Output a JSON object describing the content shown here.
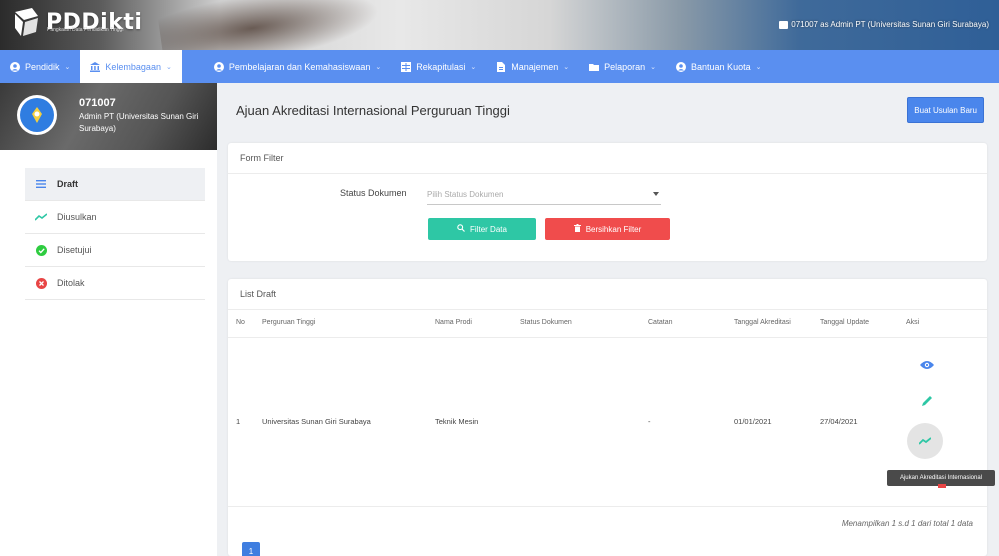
{
  "header": {
    "brand": "PDDikti",
    "brand_sub": "Pangkalan Data Pendidikan Tinggi",
    "user_label": "071007 as Admin PT (Universitas Sunan Giri Surabaya)"
  },
  "nav": {
    "items": [
      {
        "label": "Pendidik",
        "icon": "user-circle-icon"
      },
      {
        "label": "Kelembagaan",
        "icon": "institution-icon"
      },
      {
        "label": "Pembelajaran dan Kemahasiswaan",
        "icon": "user-circle-icon"
      },
      {
        "label": "Rekapitulasi",
        "icon": "table-icon"
      },
      {
        "label": "Manajemen",
        "icon": "document-icon"
      },
      {
        "label": "Pelaporan",
        "icon": "folder-icon"
      },
      {
        "label": "Bantuan Kuota",
        "icon": "user-circle-icon"
      }
    ]
  },
  "sidebar": {
    "profile_id": "071007",
    "profile_name": "Admin PT (Universitas Sunan Giri Surabaya)",
    "items": [
      {
        "label": "Draft",
        "icon": "list-icon"
      },
      {
        "label": "Diusulkan",
        "icon": "trend-icon"
      },
      {
        "label": "Disetujui",
        "icon": "check-circle-icon"
      },
      {
        "label": "Ditolak",
        "icon": "x-circle-icon"
      }
    ]
  },
  "main": {
    "title": "Ajuan Akreditasi Internasional Perguruan Tinggi",
    "new_button": "Buat Usulan Baru",
    "filter": {
      "title": "Form Filter",
      "status_label": "Status Dokumen",
      "status_placeholder": "Pilih Status Dokumen",
      "filter_button": "Filter Data",
      "clear_button": "Bersihkan Filter"
    },
    "list": {
      "title": "List Draft",
      "columns": [
        "No",
        "Perguruan Tinggi",
        "Nama Prodi",
        "Status Dokumen",
        "Catatan",
        "Tanggal Akreditasi",
        "Tanggal Update",
        "Aksi"
      ],
      "rows": [
        {
          "no": "1",
          "pt": "Universitas Sunan Giri Surabaya",
          "prodi": "Teknik Mesin",
          "status": "",
          "catatan": "-",
          "tgl_akreditasi": "01/01/2021",
          "tgl_update": "27/04/2021"
        }
      ],
      "tooltip": "Ajukan Akreditasi Internasional",
      "summary": "Menampilkan 1 s.d 1 dari total 1 data",
      "page": "1"
    }
  },
  "colors": {
    "nav": "#5a8ff0",
    "primary": "#4a86ec",
    "success": "#2ec7a5",
    "danger": "#f04c4c"
  }
}
